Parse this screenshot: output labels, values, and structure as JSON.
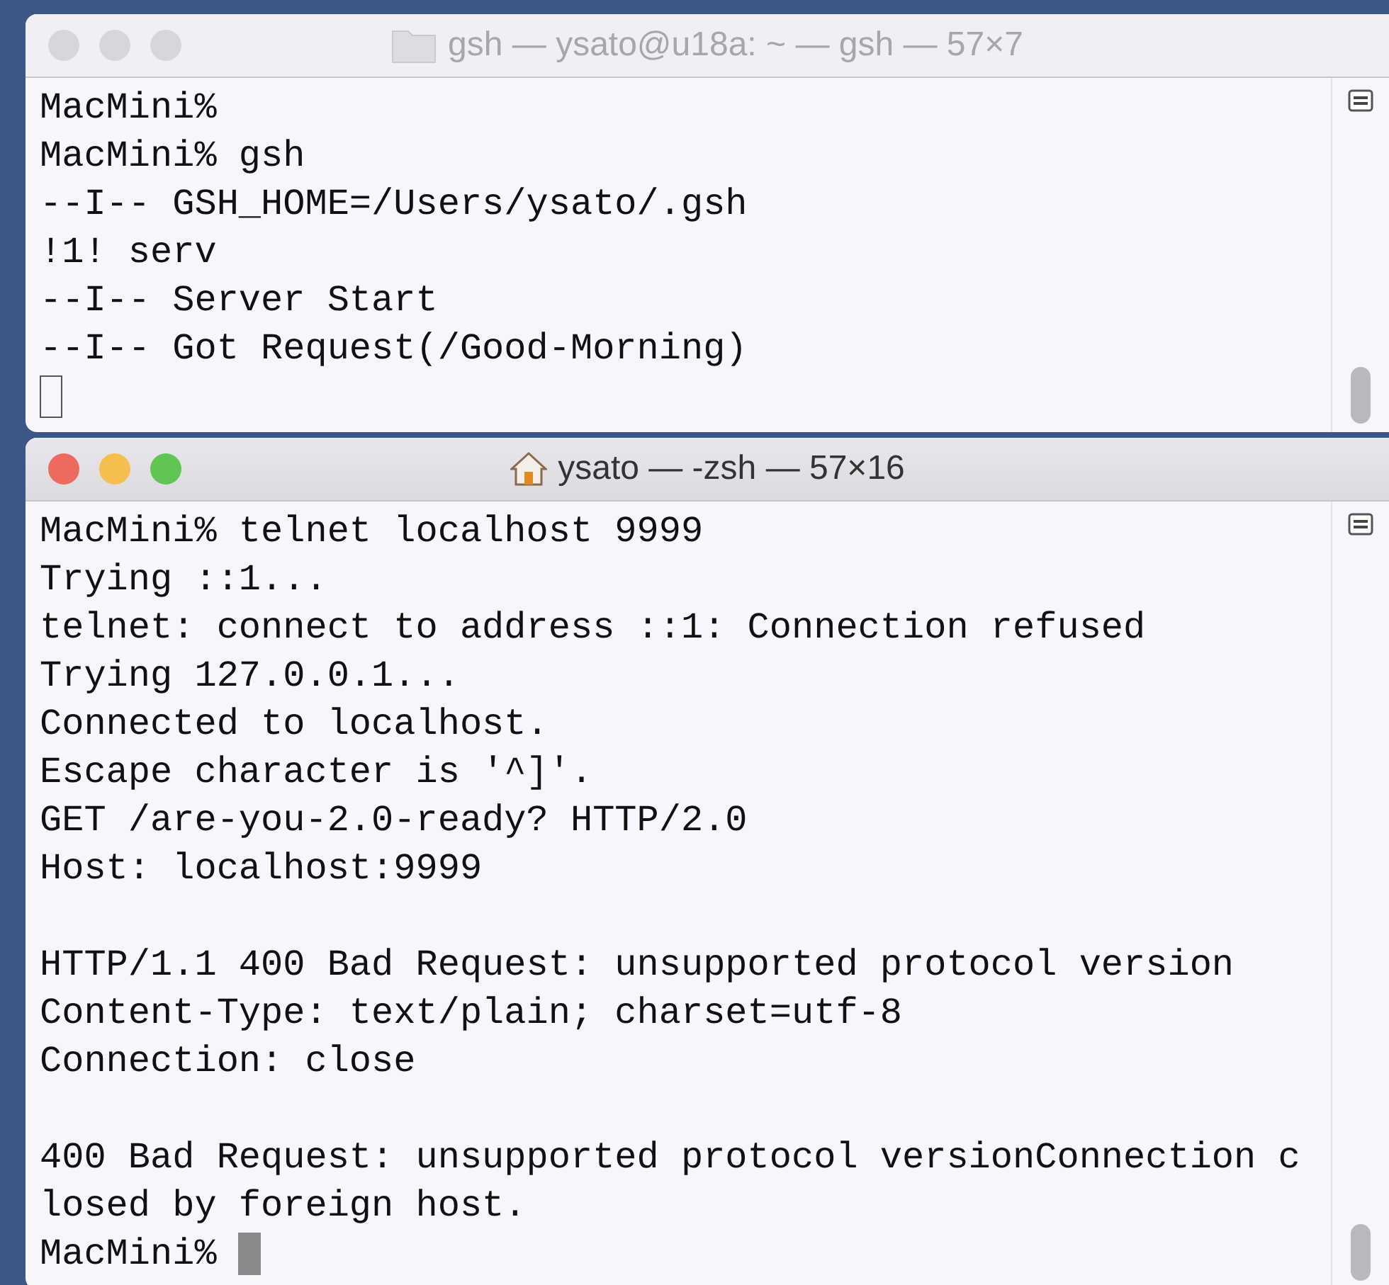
{
  "windows": [
    {
      "title": "gsh — ysato@u18a: ~ — gsh — 57×7",
      "title_icon": {
        "kind": "folder"
      },
      "active": false,
      "lines": [
        {
          "kind": "text",
          "text": "MacMini%"
        },
        {
          "kind": "text",
          "text": "MacMini% gsh"
        },
        {
          "kind": "text",
          "text": "--I-- GSH_HOME=/Users/ysato/.gsh"
        },
        {
          "kind": "text",
          "text": "!1! serv"
        },
        {
          "kind": "text",
          "text": "--I-- Server Start"
        },
        {
          "kind": "text",
          "text": "--I-- Got Request(/Good-Morning)"
        },
        {
          "kind": "cursor"
        }
      ]
    },
    {
      "title": "ysato — -zsh — 57×16",
      "title_icon": {
        "kind": "home"
      },
      "active": true,
      "lines": [
        {
          "kind": "text",
          "text": "MacMini% telnet localhost 9999"
        },
        {
          "kind": "text",
          "text": "Trying ::1..."
        },
        {
          "kind": "text",
          "text": "telnet: connect to address ::1: Connection refused"
        },
        {
          "kind": "text",
          "text": "Trying 127.0.0.1..."
        },
        {
          "kind": "text",
          "text": "Connected to localhost."
        },
        {
          "kind": "text",
          "text": "Escape character is '^]'."
        },
        {
          "kind": "text",
          "text": "GET /are-you-2.0-ready? HTTP/2.0"
        },
        {
          "kind": "text",
          "text": "Host: localhost:9999"
        },
        {
          "kind": "blank"
        },
        {
          "kind": "text",
          "text": "HTTP/1.1 400 Bad Request: unsupported protocol version"
        },
        {
          "kind": "text",
          "text": "Content-Type: text/plain; charset=utf-8"
        },
        {
          "kind": "text",
          "text": "Connection: close"
        },
        {
          "kind": "blank"
        },
        {
          "kind": "text",
          "text": "400 Bad Request: unsupported protocol versionConnection c"
        },
        {
          "kind": "text",
          "text": "losed by foreign host."
        },
        {
          "kind": "prompt",
          "text": "MacMini%"
        }
      ]
    }
  ]
}
